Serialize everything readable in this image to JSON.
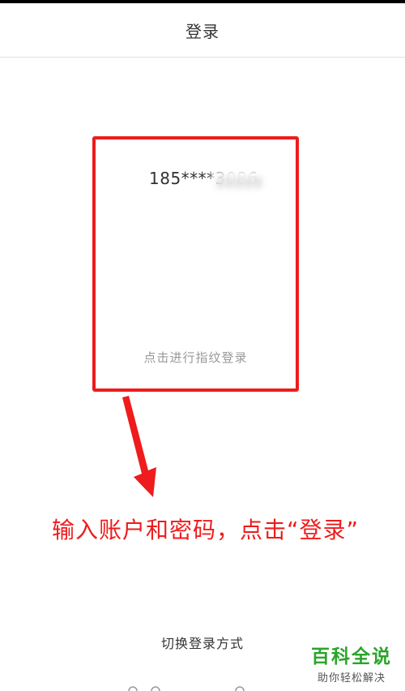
{
  "nav": {
    "title": "登录"
  },
  "account": {
    "number_visible": "185****3086"
  },
  "fingerprint": {
    "label": "点击进行指纹登录"
  },
  "annotation": {
    "instruction": "输入账户和密码，点击“登录”"
  },
  "footer": {
    "switch_label": "切换登录方式"
  },
  "watermark": {
    "title": "百科全说",
    "subtitle": "助你轻松解决"
  },
  "colors": {
    "annotation_red": "#ee1c1c",
    "watermark_green": "#2aa52a",
    "text_primary": "#333333",
    "text_muted": "#999999"
  }
}
